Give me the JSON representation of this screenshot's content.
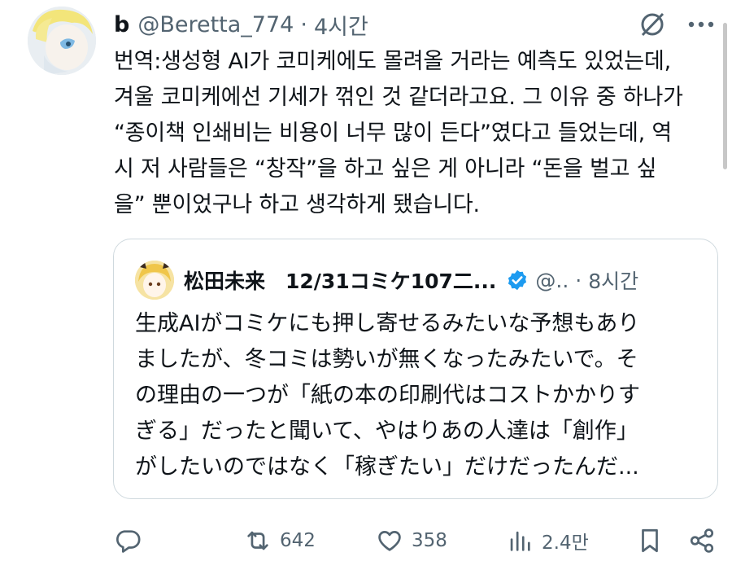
{
  "tweet": {
    "display_name": "b",
    "handle": "@Beretta_774",
    "separator": "·",
    "time": "4시간",
    "body_lines": [
      "번역:생성형 AI가 코미케에도 몰려올 거라는 예측도 있었는데,",
      "겨울 코미케에선 기세가 꺾인 것 같더라고요. 그 이유 중 하나가",
      "“종이책 인쇄비는 비용이 너무 많이 든다”였다고 들었는데, 역",
      "시 저 사람들은 “창작”을 하고 싶은 게 아니라 “돈을 벌고 싶",
      "을” 뿐이었구나 하고 생각하게 됐습니다."
    ]
  },
  "quote": {
    "display_name": "松田未来　12/31コミケ107二...",
    "handle": "@..",
    "separator": "·",
    "time": "8시간",
    "body_lines": [
      "生成AIがコミケにも押し寄せるみたいな予想もあり",
      "ましたが、冬コミは勢いが無くなったみたいで。そ",
      "の理由の一つが「紙の本の印刷代はコストかかりす",
      "ぎる」だったと聞いて、やはりあの人達は「創作」",
      "がしたいのではなく「稼ぎたい」だけだったんだ..."
    ]
  },
  "actions": {
    "reply_count": "",
    "retweet_count": "642",
    "like_count": "358",
    "views_count": "2.4만"
  },
  "colors": {
    "text": "#0f1419",
    "secondary": "#536471",
    "border": "#cfd9de",
    "verified": "#1d9bf0"
  }
}
